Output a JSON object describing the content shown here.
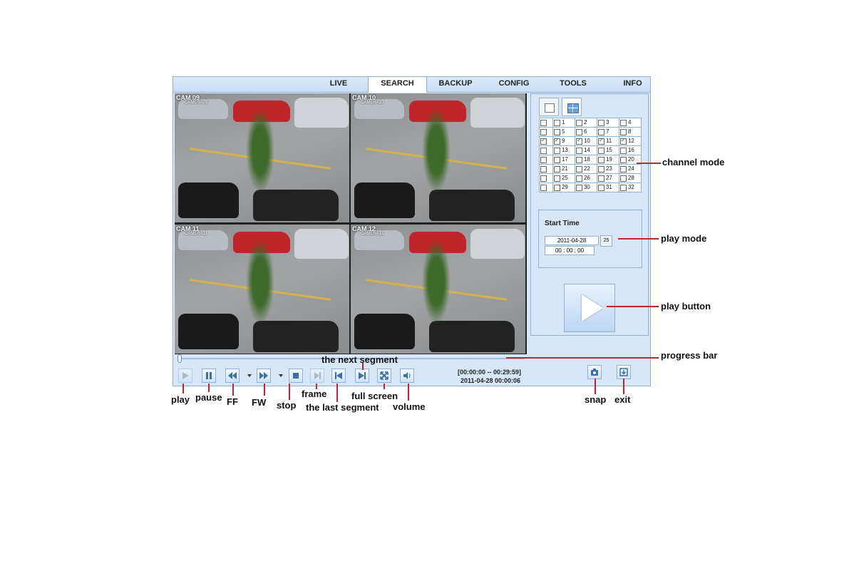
{
  "tabs": [
    "LIVE",
    "SEARCH",
    "BACKUP",
    "CONFIG",
    "TOOLS",
    "INFO"
  ],
  "active_tab": "SEARCH",
  "cameras": [
    {
      "label": "CAM 09",
      "sub": "CAMERA09"
    },
    {
      "label": "CAM 10",
      "sub": "CAMERA10"
    },
    {
      "label": "CAM 11",
      "sub": "CAMERA11"
    },
    {
      "label": "CAM 12",
      "sub": "CAMERA12"
    }
  ],
  "channel_grid": {
    "rows": [
      [
        "1",
        "2",
        "3",
        "4"
      ],
      [
        "5",
        "6",
        "7",
        "8"
      ],
      [
        "9",
        "10",
        "11",
        "12"
      ],
      [
        "13",
        "14",
        "15",
        "16"
      ],
      [
        "17",
        "18",
        "19",
        "20"
      ],
      [
        "21",
        "22",
        "23",
        "24"
      ],
      [
        "25",
        "26",
        "27",
        "28"
      ],
      [
        "29",
        "30",
        "31",
        "32"
      ]
    ],
    "checked": [
      "9",
      "10",
      "11",
      "12"
    ]
  },
  "start_time": {
    "title": "Start Time",
    "date": "2011-04-28",
    "time": "00 : 00 : 00",
    "calendar_icon": "25"
  },
  "playback": {
    "range": "[00:00:00 -- 00:29:59]",
    "current": "2011-04-28 00:00:06",
    "progress": 0.0
  },
  "annotations": {
    "channel_mode": "channel mode",
    "play_mode": "play mode",
    "play_button": "play button",
    "progress_bar": "progress bar",
    "next_segment": "the next segment",
    "play": "play",
    "pause": "pause",
    "ff": "FF",
    "fw": "FW",
    "stop": "stop",
    "frame": "frame",
    "last_segment": "the last segment",
    "full_screen": "full screen",
    "volume": "volume",
    "snap": "snap",
    "exit": "exit"
  },
  "colors": {
    "accent": "#3a6fa8",
    "annotation_line": "#c0272d",
    "panel_bg": "#d7e7f8"
  }
}
